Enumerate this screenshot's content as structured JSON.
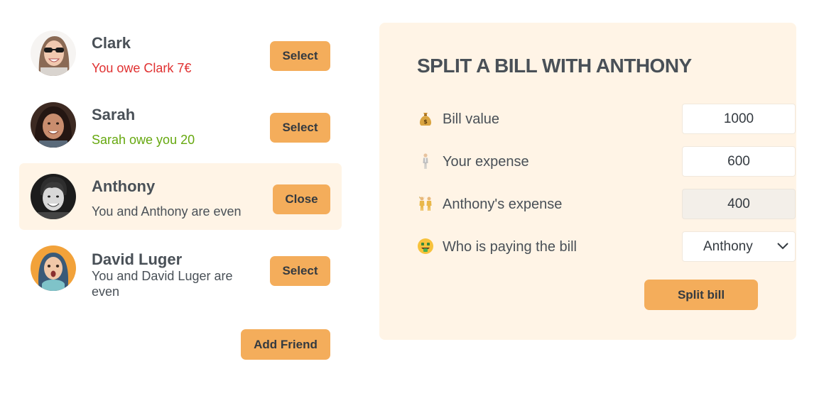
{
  "friends": [
    {
      "name": "Clark",
      "message": "You owe Clark 7€",
      "button": "Select"
    },
    {
      "name": "Sarah",
      "message": "Sarah owe you 20",
      "button": "Select"
    },
    {
      "name": "Anthony",
      "message": "You and Anthony are even",
      "button": "Close"
    },
    {
      "name": "David Luger",
      "message": "You and David Luger are even",
      "button": "Select"
    }
  ],
  "add_friend_label": "Add Friend",
  "form": {
    "title": "SPLIT A BILL WITH ANTHONY",
    "bill_value_label": "Bill value",
    "bill_value": "1000",
    "your_expense_label": "Your expense",
    "your_expense": "600",
    "friend_expense_label": "Anthony's expense",
    "friend_expense": "400",
    "payer_label": "Who is paying the bill",
    "payer_selected": "Anthony",
    "submit_label": "Split bill"
  },
  "icons": {
    "bill_value": "money-bag-icon",
    "your_expense": "person-standing-icon",
    "friend_expense": "two-people-icon",
    "payer": "money-mouth-face-icon"
  },
  "colors": {
    "accent": "#f4ad5b",
    "panel": "#fff4e6",
    "owe_red": "#e03131",
    "owed_green": "#66a80f",
    "text": "#495057"
  }
}
